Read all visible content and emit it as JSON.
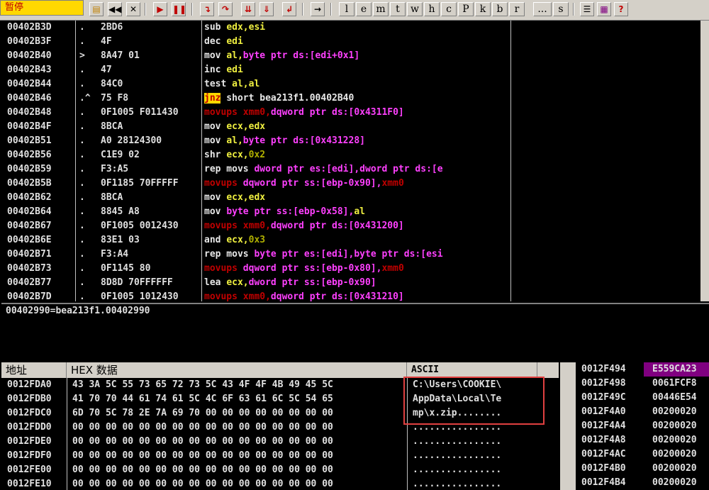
{
  "toolbar": {
    "status": "暂停",
    "letters": [
      "l",
      "e",
      "m",
      "t",
      "w",
      "h",
      "c",
      "P",
      "k",
      "b",
      "r",
      "...",
      "s"
    ]
  },
  "disasm": {
    "rows": [
      {
        "addr": "00402B3D",
        "mark": ".",
        "hex": "2BD6",
        "asm": [
          [
            "sub ",
            "w"
          ],
          [
            "edx,esi",
            "y"
          ]
        ]
      },
      {
        "addr": "00402B3F",
        "mark": ".",
        "hex": "4F",
        "asm": [
          [
            "dec ",
            "w"
          ],
          [
            "edi",
            "y"
          ]
        ]
      },
      {
        "addr": "00402B40",
        "mark": ">",
        "hex": "8A47 01",
        "asm": [
          [
            "mov ",
            "w"
          ],
          [
            "al,",
            "y"
          ],
          [
            "byte ptr ",
            "m"
          ],
          [
            "ds:[edi+0x1]",
            "m"
          ]
        ]
      },
      {
        "addr": "00402B43",
        "mark": ".",
        "hex": "47",
        "asm": [
          [
            "inc ",
            "w"
          ],
          [
            "edi",
            "y"
          ]
        ]
      },
      {
        "addr": "00402B44",
        "mark": ".",
        "hex": "84C0",
        "asm": [
          [
            "test ",
            "w"
          ],
          [
            "al,al",
            "y"
          ]
        ]
      },
      {
        "addr": "00402B46",
        "mark": ".^",
        "hex": "75 F8",
        "asm": [
          [
            "jnz",
            "hl"
          ],
          [
            " short bea213f1.00402B40",
            "w"
          ]
        ]
      },
      {
        "addr": "00402B48",
        "mark": ".",
        "hex": "0F1005 F011430",
        "asm": [
          [
            "movups xmm0,",
            "r"
          ],
          [
            "dqword ptr ds:[0x4311F0]",
            "m"
          ]
        ]
      },
      {
        "addr": "00402B4F",
        "mark": ".",
        "hex": "8BCA",
        "asm": [
          [
            "mov ",
            "w"
          ],
          [
            "ecx,edx",
            "y"
          ]
        ]
      },
      {
        "addr": "00402B51",
        "mark": ".",
        "hex": "A0 28124300",
        "asm": [
          [
            "mov ",
            "w"
          ],
          [
            "al,",
            "y"
          ],
          [
            "byte ptr ds:[0x431228]",
            "m"
          ]
        ]
      },
      {
        "addr": "00402B56",
        "mark": ".",
        "hex": "C1E9 02",
        "asm": [
          [
            "shr ",
            "w"
          ],
          [
            "ecx,",
            "y"
          ],
          [
            "0x2",
            "o"
          ]
        ]
      },
      {
        "addr": "00402B59",
        "mark": ".",
        "hex": "F3:A5",
        "asm": [
          [
            "rep movs ",
            "w"
          ],
          [
            "dword ptr es:[edi],dword ptr ds:[e",
            "m"
          ]
        ]
      },
      {
        "addr": "00402B5B",
        "mark": ".",
        "hex": "0F1185 70FFFFF",
        "asm": [
          [
            "movups ",
            "r"
          ],
          [
            "dqword ptr ss:[ebp-0x90],",
            "m"
          ],
          [
            "xmm0",
            "r"
          ]
        ]
      },
      {
        "addr": "00402B62",
        "mark": ".",
        "hex": "8BCA",
        "asm": [
          [
            "mov ",
            "w"
          ],
          [
            "ecx,edx",
            "y"
          ]
        ]
      },
      {
        "addr": "00402B64",
        "mark": ".",
        "hex": "8845 A8",
        "asm": [
          [
            "mov ",
            "w"
          ],
          [
            "byte ptr ss:[ebp-0x58],",
            "m"
          ],
          [
            "al",
            "y"
          ]
        ]
      },
      {
        "addr": "00402B67",
        "mark": ".",
        "hex": "0F1005 0012430",
        "asm": [
          [
            "movups xmm0,",
            "r"
          ],
          [
            "dqword ptr ds:[0x431200]",
            "m"
          ]
        ]
      },
      {
        "addr": "00402B6E",
        "mark": ".",
        "hex": "83E1 03",
        "asm": [
          [
            "and ",
            "w"
          ],
          [
            "ecx,",
            "y"
          ],
          [
            "0x3",
            "o"
          ]
        ]
      },
      {
        "addr": "00402B71",
        "mark": ".",
        "hex": "F3:A4",
        "asm": [
          [
            "rep movs ",
            "w"
          ],
          [
            "byte ptr es:[edi],byte ptr ds:[esi",
            "m"
          ]
        ]
      },
      {
        "addr": "00402B73",
        "mark": ".",
        "hex": "0F1145 80",
        "asm": [
          [
            "movups ",
            "r"
          ],
          [
            "dqword ptr ss:[ebp-0x80],",
            "m"
          ],
          [
            "xmm0",
            "r"
          ]
        ]
      },
      {
        "addr": "00402B77",
        "mark": ".",
        "hex": "8D8D 70FFFFFF",
        "asm": [
          [
            "lea ",
            "w"
          ],
          [
            "ecx,",
            "y"
          ],
          [
            "dword ptr ss:[ebp-0x90]",
            "m"
          ]
        ]
      },
      {
        "addr": "00402B7D",
        "mark": ".",
        "hex": "0F1005 1012430",
        "asm": [
          [
            "movups xmm0,",
            "r"
          ],
          [
            "dqword ptr ds:[0x431210]",
            "m"
          ]
        ]
      }
    ]
  },
  "info": {
    "text": "00402990=bea213f1.00402990"
  },
  "dump": {
    "headers": {
      "addr": "地址",
      "hex": "HEX 数据",
      "ascii": "ASCII"
    },
    "rows": [
      {
        "addr": "0012FDA0",
        "hex": "43 3A 5C 55 73 65 72 73 5C 43 4F 4F 4B 49 45 5C",
        "ascii": "C:\\Users\\COOKIE\\"
      },
      {
        "addr": "0012FDB0",
        "hex": "41 70 70 44 61 74 61 5C 4C 6F 63 61 6C 5C 54 65",
        "ascii": "AppData\\Local\\Te"
      },
      {
        "addr": "0012FDC0",
        "hex": "6D 70 5C 78 2E 7A 69 70 00 00 00 00 00 00 00 00",
        "ascii": "mp\\x.zip........"
      },
      {
        "addr": "0012FDD0",
        "hex": "00 00 00 00 00 00 00 00 00 00 00 00 00 00 00 00",
        "ascii": "................"
      },
      {
        "addr": "0012FDE0",
        "hex": "00 00 00 00 00 00 00 00 00 00 00 00 00 00 00 00",
        "ascii": "................"
      },
      {
        "addr": "0012FDF0",
        "hex": "00 00 00 00 00 00 00 00 00 00 00 00 00 00 00 00",
        "ascii": "................"
      },
      {
        "addr": "0012FE00",
        "hex": "00 00 00 00 00 00 00 00 00 00 00 00 00 00 00 00",
        "ascii": "................"
      },
      {
        "addr": "0012FE10",
        "hex": "00 00 00 00 00 00 00 00 00 00 00 00 00 00 00 00",
        "ascii": "................"
      }
    ]
  },
  "stack": {
    "rows": [
      {
        "addr": "0012F494",
        "val": "E559CA23",
        "selected": true
      },
      {
        "addr": "0012F498",
        "val": "0061FCF8"
      },
      {
        "addr": "0012F49C",
        "val": "00446E54"
      },
      {
        "addr": "0012F4A0",
        "val": "00200020"
      },
      {
        "addr": "0012F4A4",
        "val": "00200020"
      },
      {
        "addr": "0012F4A8",
        "val": "00200020"
      },
      {
        "addr": "0012F4AC",
        "val": "00200020"
      },
      {
        "addr": "0012F4B0",
        "val": "00200020"
      },
      {
        "addr": "0012F4B4",
        "val": "00200020"
      }
    ]
  },
  "colors": {
    "w": "#e8e8e8",
    "y": "#f0f040",
    "m": "#ff40ff",
    "r": "#c00000",
    "o": "#b0b000",
    "hl_bg": "#ffd800",
    "hl_fg": "#c00000",
    "selected_bg": "#800080"
  }
}
